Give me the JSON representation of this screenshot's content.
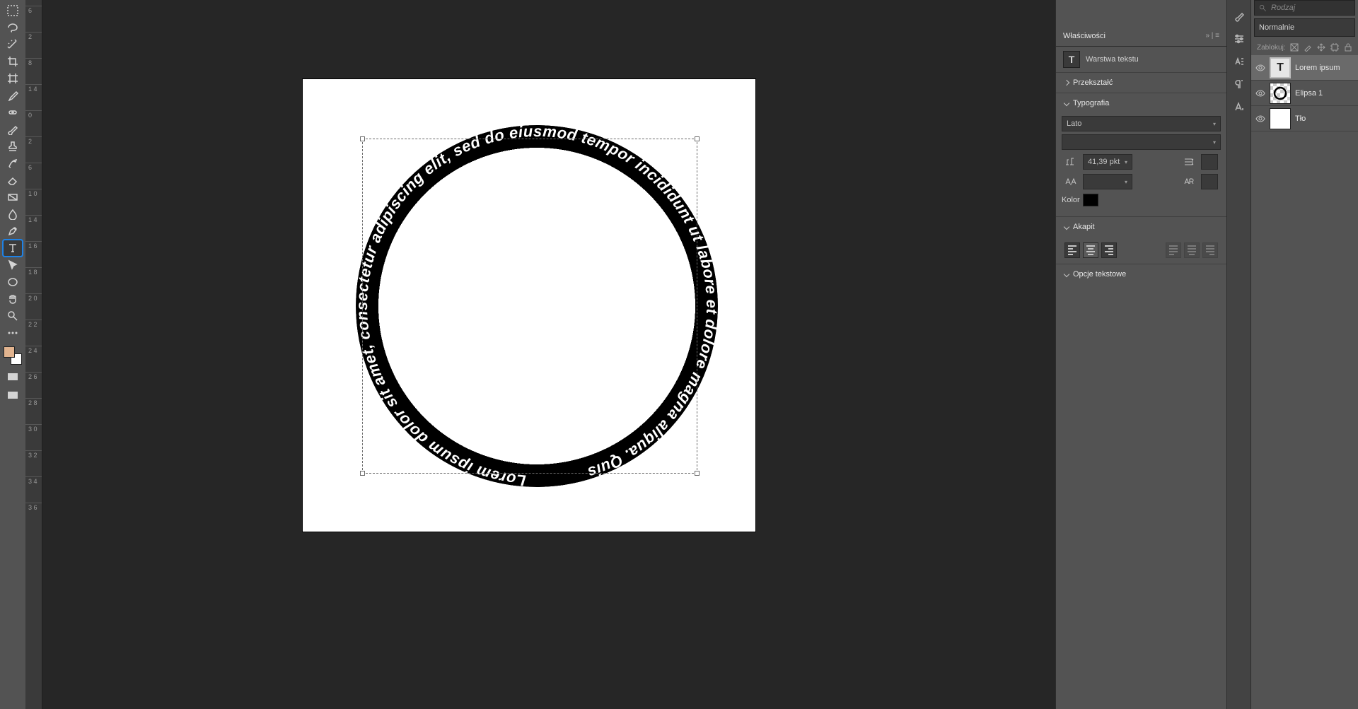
{
  "rulerTicks": [
    "6",
    "2",
    "8",
    "1 4",
    "0",
    "2",
    "6",
    "1 0",
    "1 4",
    "1 6",
    "1 8",
    "2 0",
    "2 2",
    "2 4",
    "2 6",
    "2 8",
    "3 0",
    "3 2",
    "3 4",
    "3 6"
  ],
  "canvas": {
    "pathText": "Lorem ipsum dolor sit amet, consectetur adipiscing elit, sed do eiusmod tempor incididunt ut labore et dolore magna aliqua. Quis"
  },
  "properties": {
    "title": "Właściwości",
    "layerType": "Warstwa tekstu",
    "transform": "Przekształć",
    "typography": "Typografia",
    "font": "Lato",
    "fontSize": "41,39 pkt",
    "colorLabel": "Kolor",
    "paragraph": "Akapit",
    "textOptions": "Opcje tekstowe"
  },
  "layersPanel": {
    "searchPlaceholder": "Rodzaj",
    "blendMode": "Normalnie",
    "lockLabel": "Zablokuj:",
    "items": [
      {
        "name": "Lorem ipsum",
        "kind": "text",
        "sel": true
      },
      {
        "name": "Elipsa 1",
        "kind": "shape"
      },
      {
        "name": "Tło",
        "kind": "bg"
      }
    ]
  }
}
